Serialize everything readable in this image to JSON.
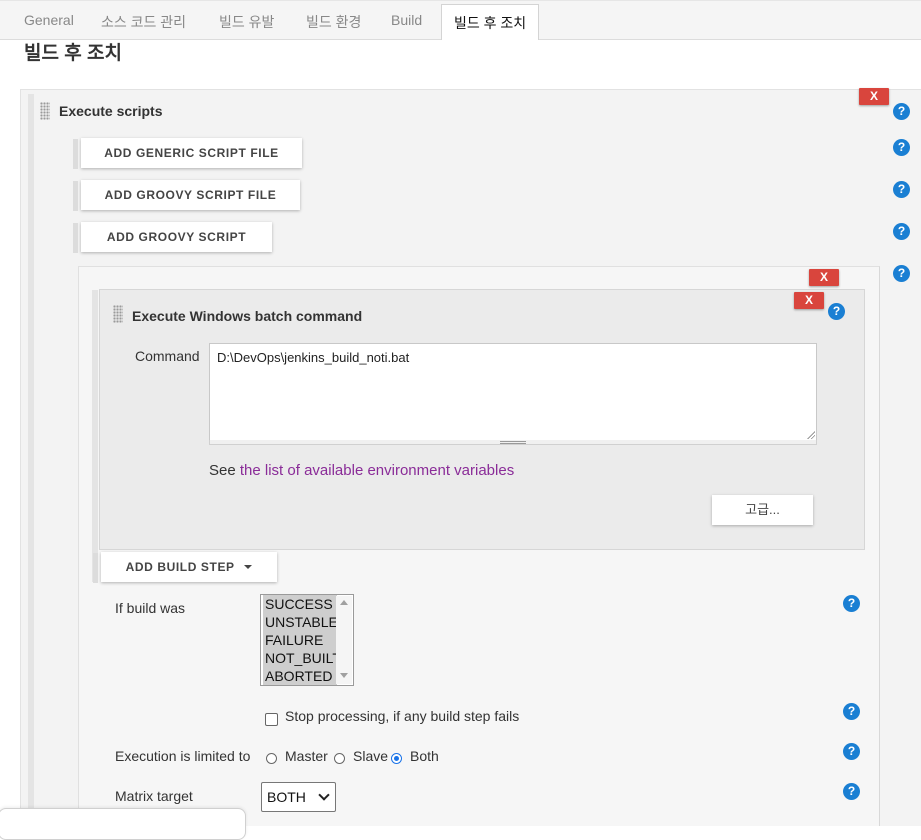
{
  "tabs": [
    {
      "label": "General"
    },
    {
      "label": "소스 코드 관리"
    },
    {
      "label": "빌드 유발"
    },
    {
      "label": "빌드 환경"
    },
    {
      "label": "Build"
    },
    {
      "label": "빌드 후 조치",
      "active": true
    }
  ],
  "section_title": "빌드 후 조치",
  "execute_scripts": {
    "title": "Execute scripts",
    "delete_label": "X",
    "buttons": [
      {
        "label": "ADD GENERIC SCRIPT FILE"
      },
      {
        "label": "ADD GROOVY SCRIPT FILE"
      },
      {
        "label": "ADD GROOVY SCRIPT"
      }
    ]
  },
  "inner_delete_label": "X",
  "batch": {
    "title": "Execute Windows batch command",
    "delete_label": "X",
    "command_label": "Command",
    "command_value": "D:\\DevOps\\jenkins_build_noti.bat",
    "see_prefix": "See",
    "env_link": "the list of available environment variables",
    "advanced_label": "고급..."
  },
  "add_build_step": {
    "label": "ADD BUILD STEP"
  },
  "if_build_was": {
    "label": "If build was",
    "options": [
      "SUCCESS",
      "UNSTABLE",
      "FAILURE",
      "NOT_BUILT",
      "ABORTED"
    ],
    "selected": [
      "SUCCESS",
      "UNSTABLE",
      "FAILURE",
      "NOT_BUILT",
      "ABORTED"
    ]
  },
  "stop_processing": {
    "label": "Stop processing, if any build step fails",
    "checked": false
  },
  "execution_limited": {
    "label": "Execution is limited to",
    "options": [
      "Master",
      "Slave",
      "Both"
    ],
    "selected": "Both"
  },
  "matrix_target": {
    "label": "Matrix target",
    "value": "BOTH"
  },
  "help_glyph": "?",
  "colors": {
    "delete": "#d9453d",
    "help": "#1a7fd3",
    "link": "#8a2c98",
    "radio": "#1a73e8"
  }
}
